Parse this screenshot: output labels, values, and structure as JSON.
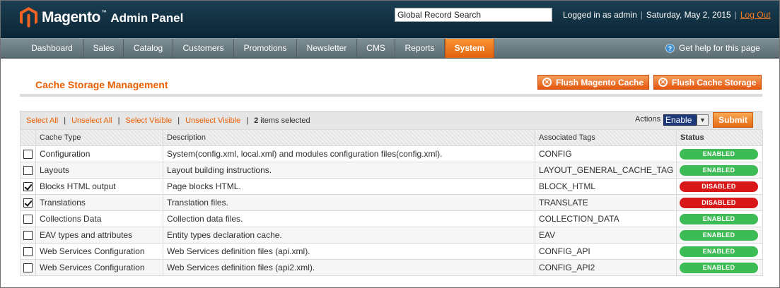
{
  "header": {
    "logo_brand": "Magento",
    "logo_tm": "™",
    "logo_sub": "Admin Panel",
    "search_value": "Global Record Search",
    "logged_in": "Logged in as admin",
    "date": "Saturday, May 2, 2015",
    "logout": "Log Out",
    "separator": "|"
  },
  "nav": {
    "items": [
      {
        "label": "Dashboard"
      },
      {
        "label": "Sales"
      },
      {
        "label": "Catalog"
      },
      {
        "label": "Customers"
      },
      {
        "label": "Promotions"
      },
      {
        "label": "Newsletter"
      },
      {
        "label": "CMS"
      },
      {
        "label": "Reports"
      },
      {
        "label": "System"
      }
    ],
    "active": "System",
    "help": "Get help for this page"
  },
  "page": {
    "title": "Cache Storage Management",
    "flush_magento": "Flush Magento Cache",
    "flush_storage": "Flush Cache Storage"
  },
  "massaction": {
    "select_all": "Select All",
    "unselect_all": "Unselect All",
    "select_visible": "Select Visible",
    "unselect_visible": "Unselect Visible",
    "sep": "|",
    "selected_count": "2",
    "selected_suffix": " items selected",
    "actions_label": "Actions",
    "actions_value": "Enable",
    "submit": "Submit"
  },
  "table": {
    "columns": [
      "Cache Type",
      "Description",
      "Associated Tags",
      "Status"
    ],
    "rows": [
      {
        "checked": false,
        "type": "Configuration",
        "description": "System(config.xml, local.xml) and modules configuration files(config.xml).",
        "tags": "CONFIG",
        "status": "ENABLED"
      },
      {
        "checked": false,
        "type": "Layouts",
        "description": "Layout building instructions.",
        "tags": "LAYOUT_GENERAL_CACHE_TAG",
        "status": "ENABLED"
      },
      {
        "checked": true,
        "type": "Blocks HTML output",
        "description": "Page blocks HTML.",
        "tags": "BLOCK_HTML",
        "status": "DISABLED"
      },
      {
        "checked": true,
        "type": "Translations",
        "description": "Translation files.",
        "tags": "TRANSLATE",
        "status": "DISABLED"
      },
      {
        "checked": false,
        "type": "Collections Data",
        "description": "Collection data files.",
        "tags": "COLLECTION_DATA",
        "status": "ENABLED"
      },
      {
        "checked": false,
        "type": "EAV types and attributes",
        "description": "Entity types declaration cache.",
        "tags": "EAV",
        "status": "ENABLED"
      },
      {
        "checked": false,
        "type": "Web Services Configuration",
        "description": "Web Services definition files (api.xml).",
        "tags": "CONFIG_API",
        "status": "ENABLED"
      },
      {
        "checked": false,
        "type": "Web Services Configuration",
        "description": "Web Services definition files (api2.xml).",
        "tags": "CONFIG_API2",
        "status": "ENABLED"
      }
    ]
  },
  "colors": {
    "accent": "#eb5e00",
    "enabled": "#3dbb55",
    "disabled": "#d81818",
    "header_bg": "#0c2a3c"
  }
}
